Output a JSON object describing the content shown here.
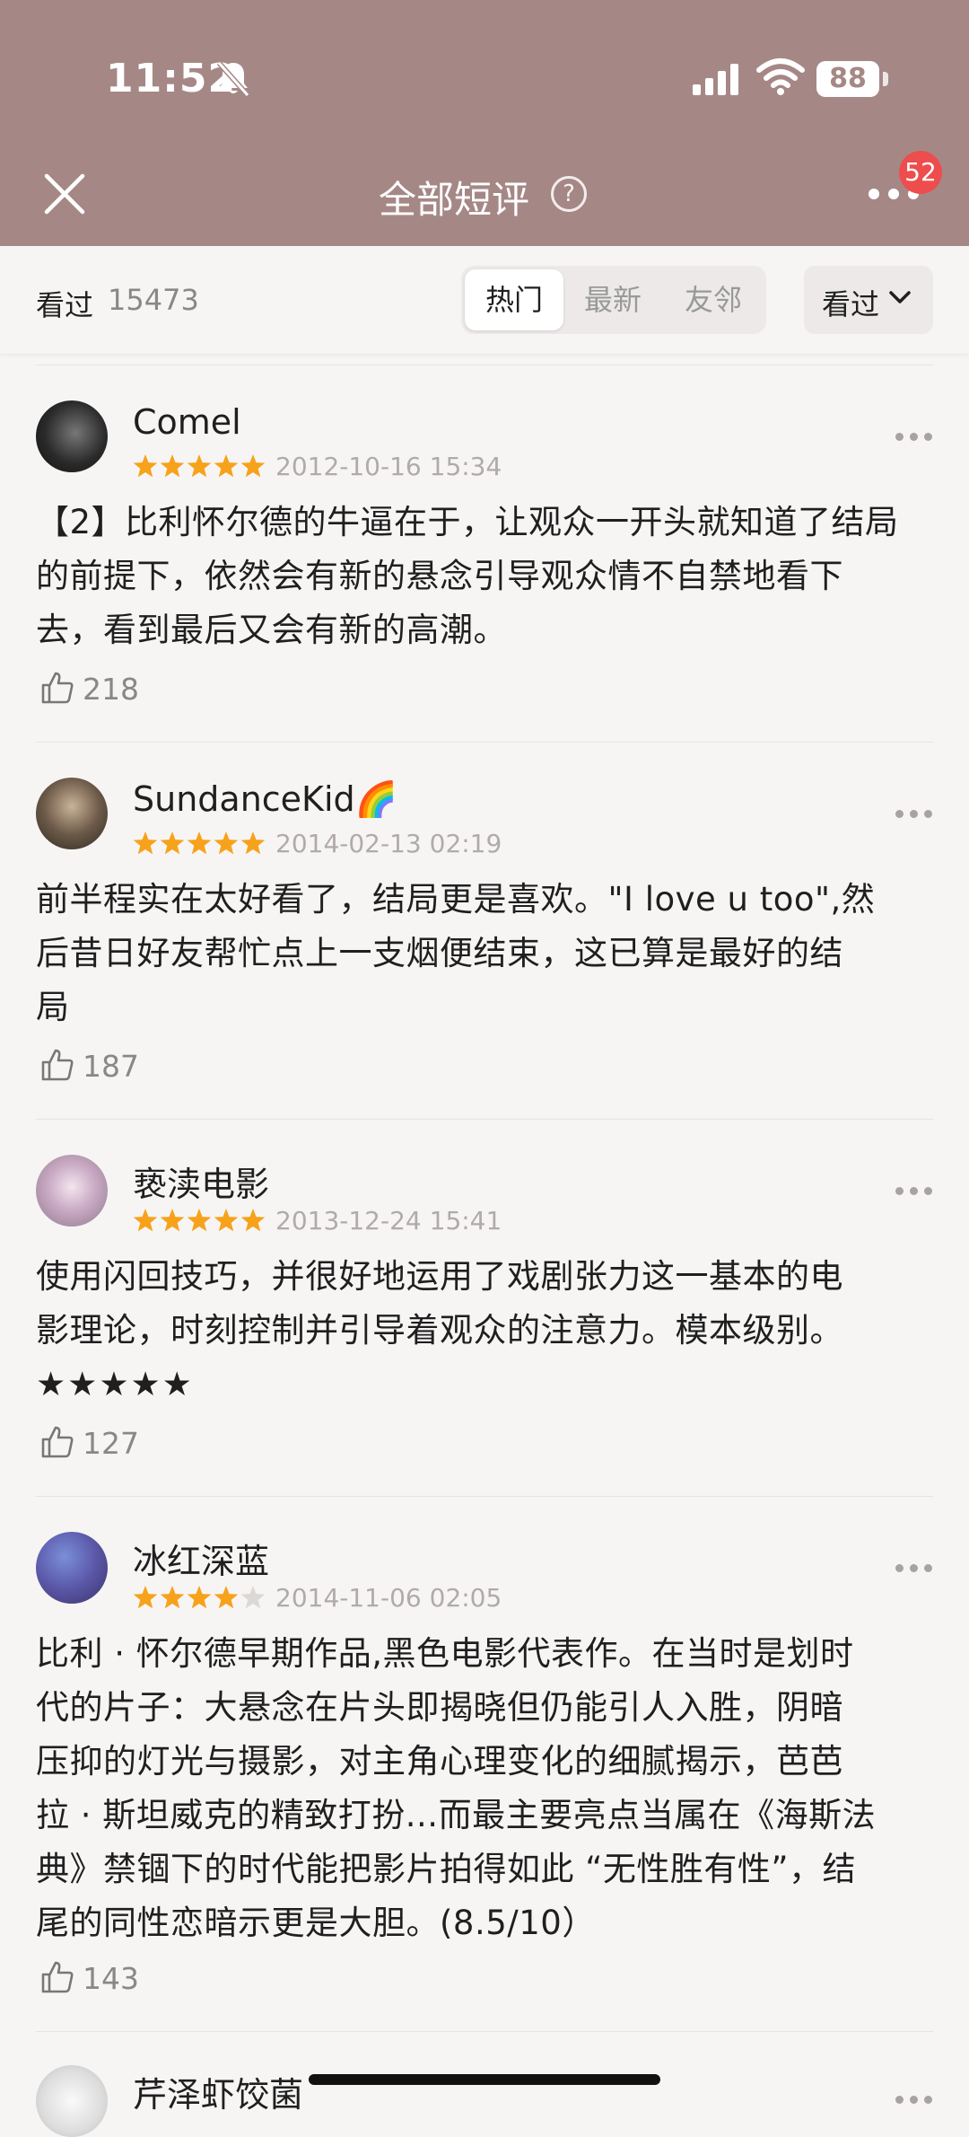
{
  "status_bar": {
    "time": "11:52",
    "battery": "88"
  },
  "header": {
    "title": "全部短评",
    "help_glyph": "?",
    "notification_count": "52"
  },
  "filter": {
    "seen_label": "看过",
    "seen_count": "15473",
    "tabs": [
      {
        "label": "热门",
        "active": true
      },
      {
        "label": "最新",
        "active": false
      },
      {
        "label": "友邻",
        "active": false
      }
    ],
    "status_dropdown": "看过"
  },
  "reviews": [
    {
      "user": "Comel",
      "rating": 5,
      "date": "2012-10-16 15:34",
      "lines": [
        "【2】比利怀尔德的牛逼在于，让观众一开头就知道了结局",
        "的前提下，依然会有新的悬念引导观众情不自禁地看下",
        "去，看到最后又会有新的高潮。"
      ],
      "votes": "218"
    },
    {
      "user": "SundanceKid🌈",
      "rating": 5,
      "date": "2014-02-13 02:19",
      "lines": [
        "前半程实在太好看了，结局更是喜欢。\"I love u too\",然",
        "后昔日好友帮忙点上一支烟便结束，这已算是最好的结",
        "局"
      ],
      "votes": "187"
    },
    {
      "user": "亵渎电影",
      "rating": 5,
      "date": "2013-12-24 15:41",
      "lines": [
        "使用闪回技巧，并很好地运用了戏剧张力这一基本的电",
        "影理论，时刻控制并引导着观众的注意力。模本级别。",
        "★★★★★"
      ],
      "votes": "127"
    },
    {
      "user": "冰红深蓝",
      "rating": 4,
      "date": "2014-11-06 02:05",
      "lines": [
        "比利 · 怀尔德早期作品,黑色电影代表作。在当时是划时",
        "代的片子：大悬念在片头即揭晓但仍能引人入胜，阴暗",
        "压抑的灯光与摄影，对主角心理变化的细腻揭示，芭芭",
        "拉 · 斯坦威克的精致打扮...而最主要亮点当属在《海斯法",
        "典》禁锢下的时代能把影片拍得如此 “无性胜有性”，结",
        "尾的同性恋暗示更是大胆。(8.5/10）"
      ],
      "votes": "143"
    },
    {
      "user": "芹泽虾饺菌",
      "rating": 0,
      "date": "",
      "lines": [],
      "votes": ""
    }
  ],
  "colors": {
    "header_bg": "#a58886",
    "star_filled": "#f7a21b",
    "star_empty": "#dcd8d6",
    "badge": "#ee4d4d"
  },
  "icons": [
    "bell-off-icon",
    "signal-icon",
    "wifi-icon",
    "close-icon",
    "help-icon",
    "more-icon",
    "chevron-down-icon",
    "thumbs-up-icon",
    "star-icon"
  ]
}
